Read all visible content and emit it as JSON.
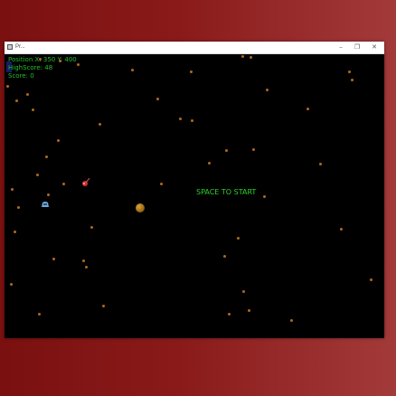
{
  "window": {
    "title": "Pr...",
    "min_glyph": "–",
    "max_glyph": "❐",
    "close_glyph": "✕"
  },
  "hud": {
    "position": "Position X: 350 Y: 400",
    "highscore": "HighScore: 48",
    "score": "Score: 0"
  },
  "game": {
    "start_message": "SPACE TO START",
    "hud_color": "#22c02a",
    "star_color": "#b06a1c",
    "planet_color": "#c7901f",
    "ship_color": "#6fa8d8",
    "enemy_color": "#d03030"
  }
}
